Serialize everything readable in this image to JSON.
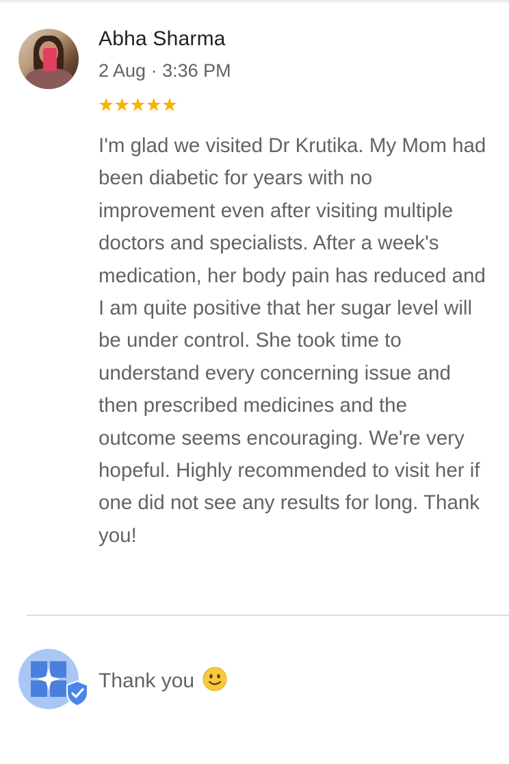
{
  "review": {
    "author": "Abha Sharma",
    "date": "2 Aug · 3:36 PM",
    "rating": 5,
    "stars": "★★★★★",
    "text": "I'm glad we visited Dr Krutika. My Mom had been diabetic for years with no improvement even after visiting multiple doctors and specialists. After a week's medication, her body pain has reduced and I am quite positive that her sugar level will be under control. She took time to understand every concerning issue and then prescribed medicines and the outcome seems encouraging. We're very hopeful. Highly recommended to visit her if one did not see any results for long. Thank you!"
  },
  "reply": {
    "text": "Thank you",
    "emoji_icon": "slightly-smiling-face-icon",
    "avatar_icon": "medical-cross-logo-icon",
    "badge_icon": "verified-shield-icon"
  },
  "colors": {
    "star": "#f4b400",
    "body_text": "#5f6368",
    "name_text": "#202124",
    "reply_avatar_bg": "#a9c7f5",
    "reply_logo": "#4a7fe0",
    "verified_badge": "#4a86e8",
    "divider": "#dcdcdc"
  }
}
